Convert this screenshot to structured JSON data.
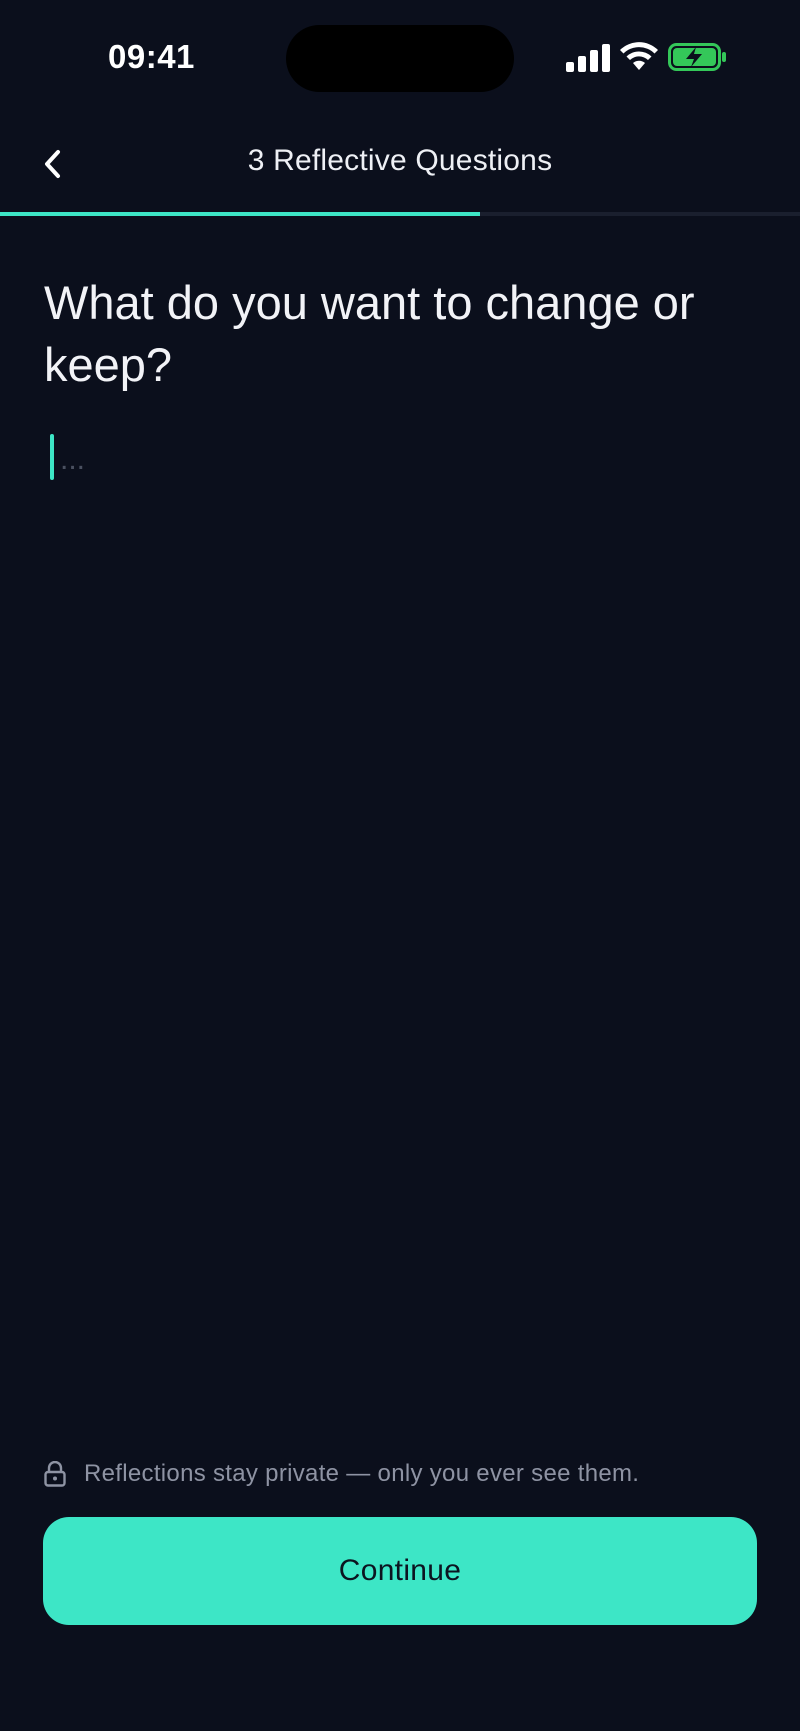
{
  "status_bar": {
    "time": "09:41",
    "icons": [
      "signal-icon",
      "wifi-icon",
      "battery-charging-icon"
    ],
    "battery_color": "#34c759"
  },
  "header": {
    "back_icon": "chevron-left-icon",
    "title": "3 Reflective Questions",
    "progress": 0.6
  },
  "question": {
    "text": "What do you want to change or keep?"
  },
  "answer": {
    "value": "",
    "placeholder": "..."
  },
  "privacy": {
    "icon": "lock-icon",
    "text": "Reflections stay private — only you ever see them."
  },
  "continue_button": {
    "label": "Continue"
  },
  "colors": {
    "background": "#0b0f1c",
    "accent": "#3de6c6",
    "muted_text": "#8e93a3"
  }
}
